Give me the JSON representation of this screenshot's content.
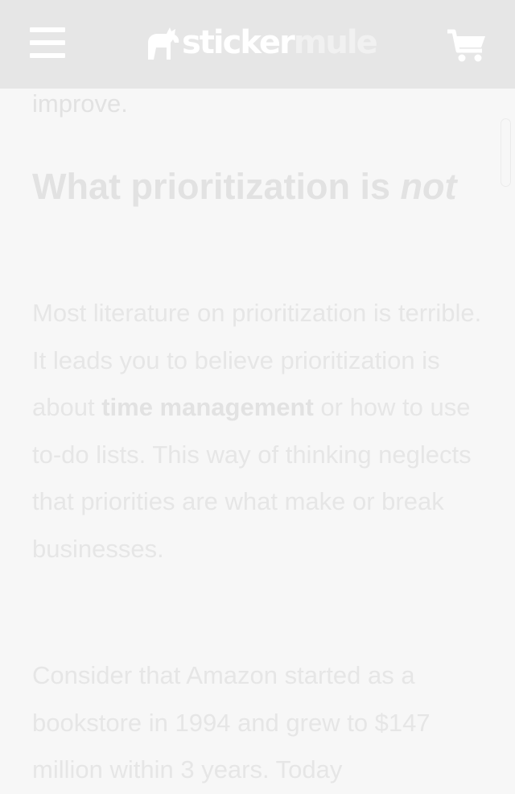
{
  "header": {
    "menu_label": "Menu",
    "brand": {
      "word1": "sticker",
      "word2": "mule"
    },
    "cart_label": "Cart"
  },
  "article": {
    "previous_fragment": "improve.",
    "heading": {
      "main": "What prioritization is ",
      "emphasis": "not"
    },
    "paragraph1": {
      "before": "Most literature on prioritization is terrible. It leads you to believe prioritization is about ",
      "strong": "time management",
      "after": " or how to use to-do lists. This way of thinking neglects that priorities are what make or break businesses."
    },
    "paragraph2": {
      "text": "Consider that Amazon started as a bookstore in 1994 and grew to $147 million within 3 years. Today"
    }
  },
  "colors": {
    "header_bg": "#e6e6e6",
    "page_bg": "#f7f7f7",
    "text": "#e2e2e2",
    "icon": "#ffffff"
  },
  "icons": [
    "hamburger-menu-icon",
    "horse-logo-icon",
    "shopping-cart-icon"
  ]
}
